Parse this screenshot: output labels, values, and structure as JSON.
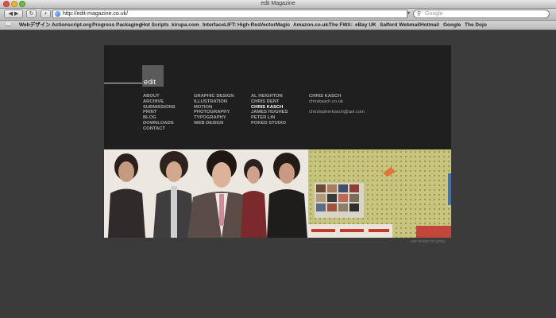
{
  "window": {
    "title": "edit Magazine"
  },
  "toolbar": {
    "url": "http://edit-magazine.co.uk/",
    "search_placeholder": "Google"
  },
  "bookmarks": [
    "Webデザイン",
    "Actionscript.org",
    "Progress Packaging",
    "Hot Scripts",
    "kirupa.com",
    "InterfaceLIFT: High-Res",
    "VectorMagic",
    "Amazon.co.uk:",
    "The FWA:",
    "eBay UK",
    "Salford Webmail",
    "Hotmail",
    "Google",
    "The Dojo"
  ],
  "site": {
    "logo": "edit",
    "nav": [
      "ABOUT",
      "ARCHIVE",
      "SUBMISSIONS",
      "PRINT",
      "BLOG",
      "DOWNLOADS",
      "CONTACT"
    ],
    "categories": [
      "GRAPHIC DESIGN",
      "ILLUSTRATION",
      "MOTION",
      "PHOTOGRAPHY",
      "TYPOGRAPHY",
      "WEB DESIGN"
    ],
    "people": [
      "AL HEIGHTON",
      "CHRIS DENT",
      "CHRIS KASCH",
      "JAMES HUGHES",
      "PETER LIN",
      "POKED STUDIO"
    ],
    "active_person": "CHRIS KASCH",
    "contact": {
      "name": "CHRIS KASCH",
      "site": "chriskasch.co.uk",
      "email": "christopherkasch@aol.com"
    },
    "credit": "site design by golyy"
  },
  "colors": {
    "page_bg": "#3b3b3b",
    "site_bg": "#1f1f1f",
    "nav_text": "#a8a8a8",
    "active_text": "#ffffff"
  }
}
